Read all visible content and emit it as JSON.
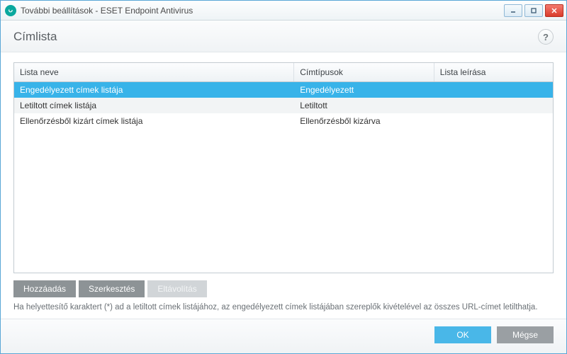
{
  "window": {
    "title": "További beállítások - ESET Endpoint Antivirus"
  },
  "header": {
    "title": "Címlista",
    "help_tooltip": "?"
  },
  "table": {
    "columns": {
      "name": "Lista neve",
      "type": "Címtípusok",
      "desc": "Lista leírása"
    },
    "rows": [
      {
        "name": "Engedélyezett címek listája",
        "type": "Engedélyezett",
        "desc": "",
        "selected": true
      },
      {
        "name": "Letiltott címek listája",
        "type": "Letiltott",
        "desc": "",
        "selected": false
      },
      {
        "name": "Ellenőrzésből kizárt címek listája",
        "type": "Ellenőrzésből kizárva",
        "desc": "",
        "selected": false
      }
    ]
  },
  "actions": {
    "add": "Hozzáadás",
    "edit": "Szerkesztés",
    "remove": "Eltávolítás"
  },
  "hint": "Ha helyettesítő karaktert (*) ad a letiltott címek listájához, az engedélyezett címek listájában szereplők kivételével az összes URL-címet letilthatja.",
  "footer": {
    "ok": "OK",
    "cancel": "Mégse"
  }
}
